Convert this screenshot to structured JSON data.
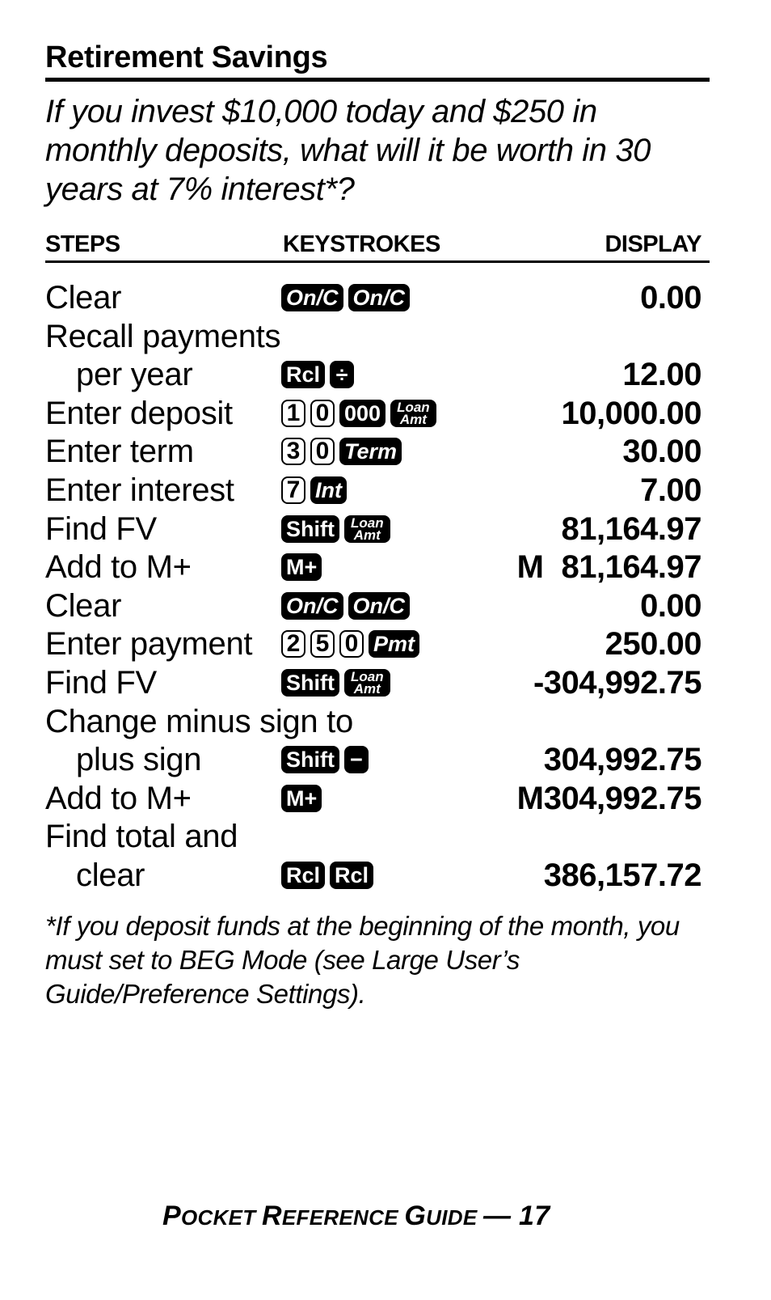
{
  "title": "Retirement Savings",
  "question": "If you invest $10,000 today and $250 in monthly deposits, what will it be worth in 30 years at 7% interest*?",
  "columns": {
    "steps": "STEPS",
    "keystrokes": "KEYSTROKES",
    "display": "DISPLAY"
  },
  "rows": [
    {
      "step": "Clear",
      "keys": [
        {
          "label": "On/C",
          "style": "dark-italic"
        },
        {
          "label": "On/C",
          "style": "dark-italic"
        }
      ],
      "memory": "",
      "display": "0.00"
    },
    {
      "step": "Recall payments",
      "keys": [],
      "memory": "",
      "display": ""
    },
    {
      "step": "per year",
      "keys": [
        {
          "label": "Rcl",
          "style": "dark"
        },
        {
          "label": "÷",
          "style": "dark-symbol"
        }
      ],
      "memory": "",
      "display": "12.00"
    },
    {
      "step": "Enter deposit",
      "keys": [
        {
          "label": "1",
          "style": "light"
        },
        {
          "label": "0",
          "style": "light"
        },
        {
          "label": "000",
          "style": "dark"
        },
        {
          "label": "Loan Amt",
          "top": "Loan",
          "bottom": "Amt",
          "style": "dark-stack"
        }
      ],
      "memory": "",
      "display": "10,000.00"
    },
    {
      "step": "Enter term",
      "keys": [
        {
          "label": "3",
          "style": "light"
        },
        {
          "label": "0",
          "style": "light"
        },
        {
          "label": "Term",
          "style": "dark-italic"
        }
      ],
      "memory": "",
      "display": "30.00"
    },
    {
      "step": "Enter interest",
      "keys": [
        {
          "label": "7",
          "style": "light"
        },
        {
          "label": "Int",
          "style": "dark-italic"
        }
      ],
      "memory": "",
      "display": "7.00"
    },
    {
      "step": "Find FV",
      "keys": [
        {
          "label": "Shift",
          "style": "dark"
        },
        {
          "label": "Loan Amt",
          "top": "Loan",
          "bottom": "Amt",
          "style": "dark-stack"
        }
      ],
      "memory": "",
      "display": "81,164.97"
    },
    {
      "step": "Add to M+",
      "keys": [
        {
          "label": "M+",
          "style": "dark"
        }
      ],
      "memory": "M",
      "display": "81,164.97"
    },
    {
      "step": "Clear",
      "keys": [
        {
          "label": "On/C",
          "style": "dark-italic"
        },
        {
          "label": "On/C",
          "style": "dark-italic"
        }
      ],
      "memory": "",
      "display": "0.00"
    },
    {
      "step": "Enter payment",
      "keys": [
        {
          "label": "2",
          "style": "light"
        },
        {
          "label": "5",
          "style": "light"
        },
        {
          "label": "0",
          "style": "light"
        },
        {
          "label": "Pmt",
          "style": "dark-italic"
        }
      ],
      "memory": "",
      "display": "250.00"
    },
    {
      "step": "Find FV",
      "keys": [
        {
          "label": "Shift",
          "style": "dark"
        },
        {
          "label": "Loan Amt",
          "top": "Loan",
          "bottom": "Amt",
          "style": "dark-stack"
        }
      ],
      "memory": "",
      "display": "-304,992.75"
    },
    {
      "step": "Change minus sign to",
      "keys": [],
      "memory": "",
      "display": ""
    },
    {
      "step": "plus sign",
      "keys": [
        {
          "label": "Shift",
          "style": "dark"
        },
        {
          "label": "−",
          "style": "dark-symbol"
        }
      ],
      "memory": "",
      "display": "304,992.75"
    },
    {
      "step": "Add to M+",
      "keys": [
        {
          "label": "M+",
          "style": "dark"
        }
      ],
      "memory": "M",
      "display": "304,992.75"
    },
    {
      "step": "Find total and",
      "keys": [],
      "memory": "",
      "display": ""
    },
    {
      "step": "clear",
      "keys": [
        {
          "label": "Rcl",
          "style": "dark"
        },
        {
          "label": "Rcl",
          "style": "dark"
        }
      ],
      "memory": "",
      "display": "386,157.72"
    }
  ],
  "footnote": "*If you deposit funds at the beginning of the month, you must set to BEG Mode (see Large User’s Guide/Preference Settings).",
  "footer": {
    "text": "Pocket Reference Guide",
    "separator": "—",
    "page_number": "17"
  }
}
